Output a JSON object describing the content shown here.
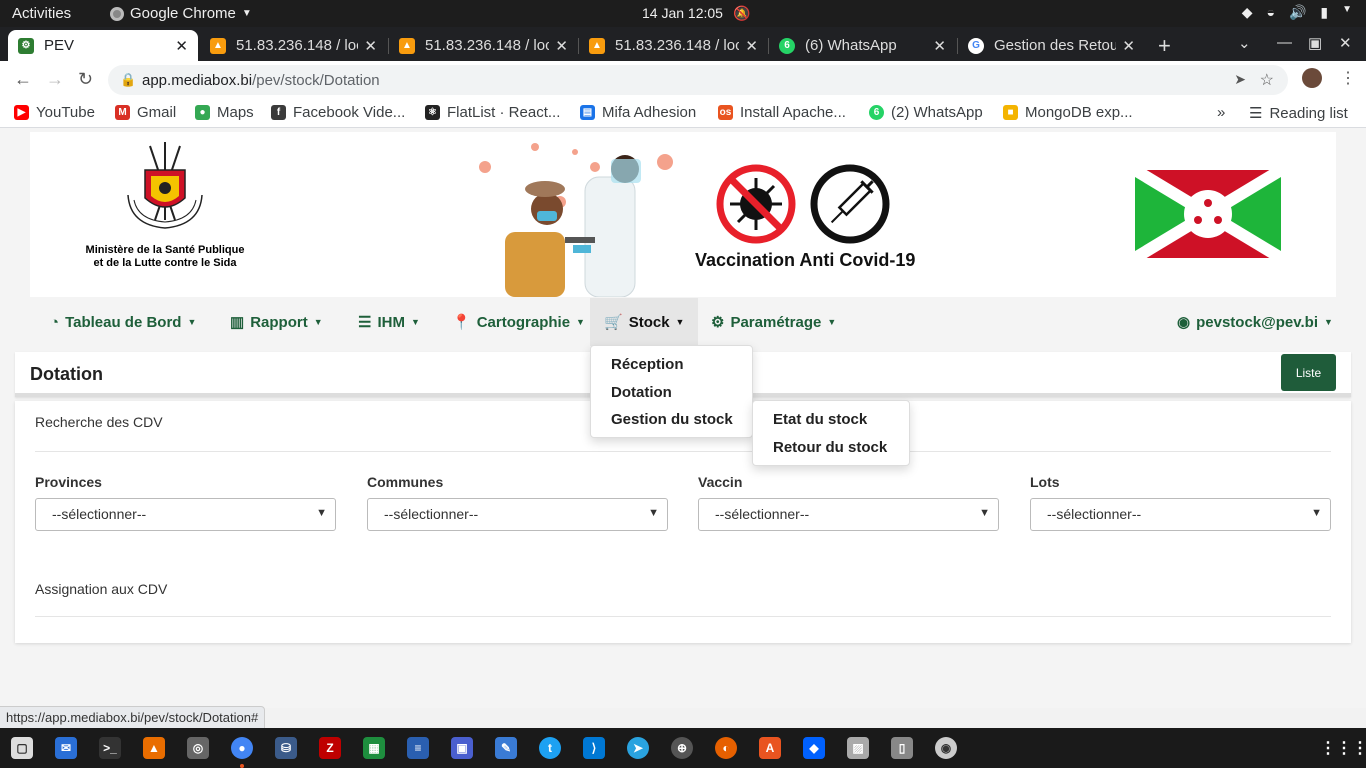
{
  "topbar": {
    "activities": "Activities",
    "app_name": "Google Chrome",
    "clock": "14 Jan  12:05"
  },
  "tabs": [
    {
      "title": "PEV",
      "active": true
    },
    {
      "title": "51.83.236.148 / loc",
      "active": false
    },
    {
      "title": "51.83.236.148 / loc",
      "active": false
    },
    {
      "title": "51.83.236.148 / loc",
      "active": false
    },
    {
      "title": "(6) WhatsApp",
      "active": false
    },
    {
      "title": "Gestion des Retou",
      "active": false
    }
  ],
  "address": {
    "domain": "app.mediabox.bi",
    "path": "/pev/stock/Dotation"
  },
  "bookmarks": [
    {
      "label": "YouTube",
      "icon": "youtube-icon",
      "color": "#ff0000"
    },
    {
      "label": "Gmail",
      "icon": "gmail-icon",
      "color": "#d93025"
    },
    {
      "label": "Maps",
      "icon": "maps-icon",
      "color": "#34a853"
    },
    {
      "label": "Facebook Vide...",
      "icon": "facebook-icon",
      "color": "#3b3b3b"
    },
    {
      "label": "FlatList · React...",
      "icon": "react-icon",
      "color": "#222"
    },
    {
      "label": "Mifa Adhesion",
      "icon": "document-icon",
      "color": "#1a73e8"
    },
    {
      "label": "Install Apache...",
      "icon": "os-icon",
      "color": "#e95420"
    },
    {
      "label": "(2) WhatsApp",
      "icon": "whatsapp-icon",
      "color": "#25d366"
    },
    {
      "label": "MongoDB exp...",
      "icon": "mongodb-icon",
      "color": "#f4b400"
    }
  ],
  "reading_list": "Reading list",
  "banner": {
    "ministry_line1": "Ministère de la Santé Publique",
    "ministry_line2": "et de la Lutte contre le Sida",
    "campaign": "Vaccination Anti Covid-19"
  },
  "nav": {
    "dashboard": "Tableau de Bord",
    "report": "Rapport",
    "ihm": "IHM",
    "map": "Cartographie",
    "stock": "Stock",
    "settings": "Paramétrage",
    "user": "pevstock@pev.bi"
  },
  "stock_menu": {
    "reception": "Réception",
    "dotation": "Dotation",
    "gestion": "Gestion du stock"
  },
  "gestion_submenu": {
    "etat": "Etat du stock",
    "retour": "Retour du stock"
  },
  "page": {
    "title": "Dotation",
    "list_button": "Liste",
    "search_section": "Recherche des CDV",
    "assign_section": "Assignation aux CDV",
    "fields": [
      {
        "label": "Provinces",
        "value": "--sélectionner--"
      },
      {
        "label": "Communes",
        "value": "--sélectionner--"
      },
      {
        "label": "Vaccin",
        "value": "--sélectionner--"
      },
      {
        "label": "Lots",
        "value": "--sélectionner--"
      }
    ]
  },
  "status_url": "https://app.mediabox.bi/pev/stock/Dotation#",
  "colors": {
    "brand_green": "#1f5c3a",
    "nav_text": "#1e5f3a",
    "flag_red": "#ce1126",
    "flag_green": "#1eb53a"
  }
}
